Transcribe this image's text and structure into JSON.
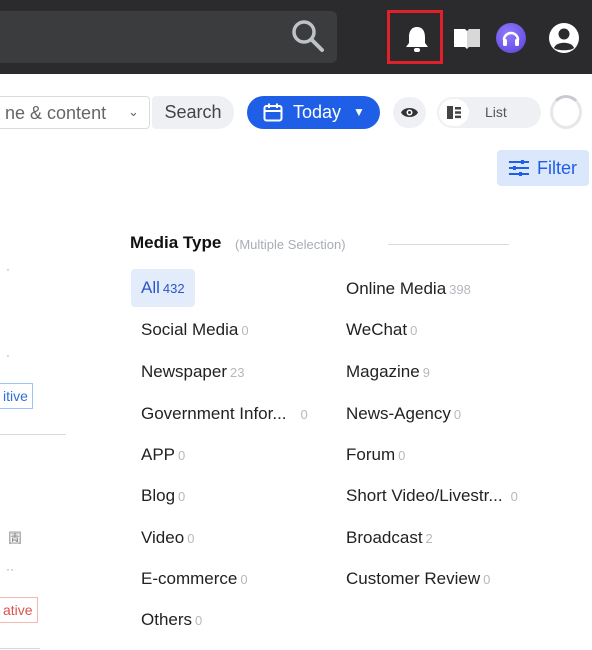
{
  "header": {
    "icons": [
      "search-icon",
      "bell-icon",
      "book-icon",
      "headset-icon",
      "user-icon"
    ],
    "highlight_color": "#e0212b"
  },
  "toolbar": {
    "scope_text": "ne & content",
    "search_label": "Search",
    "date_label": "Today",
    "view_label": "List",
    "accent": "#1f5ee6"
  },
  "filter": {
    "label": "Filter"
  },
  "left_list": {
    "tag_positive": "itive",
    "tag_negative": "ative",
    "glyph": "圊"
  },
  "media_type": {
    "title": "Media Type",
    "subtitle": "(Multiple Selection)",
    "items": [
      {
        "label": "All",
        "count": "432"
      },
      {
        "label": "Online Media",
        "count": "398"
      },
      {
        "label": "Social Media",
        "count": "0"
      },
      {
        "label": "WeChat",
        "count": "0"
      },
      {
        "label": "Newspaper",
        "count": "23"
      },
      {
        "label": "Magazine",
        "count": "9"
      },
      {
        "label": "Government Infor...",
        "count": "0"
      },
      {
        "label": "News-Agency",
        "count": "0"
      },
      {
        "label": "APP",
        "count": "0"
      },
      {
        "label": "Forum",
        "count": "0"
      },
      {
        "label": "Blog",
        "count": "0"
      },
      {
        "label": "Short Video/Livestr...",
        "count": "0"
      },
      {
        "label": "Video",
        "count": "0"
      },
      {
        "label": "Broadcast",
        "count": "2"
      },
      {
        "label": "E-commerce",
        "count": "0"
      },
      {
        "label": "Customer Review",
        "count": "0"
      },
      {
        "label": "Others",
        "count": "0"
      }
    ]
  }
}
